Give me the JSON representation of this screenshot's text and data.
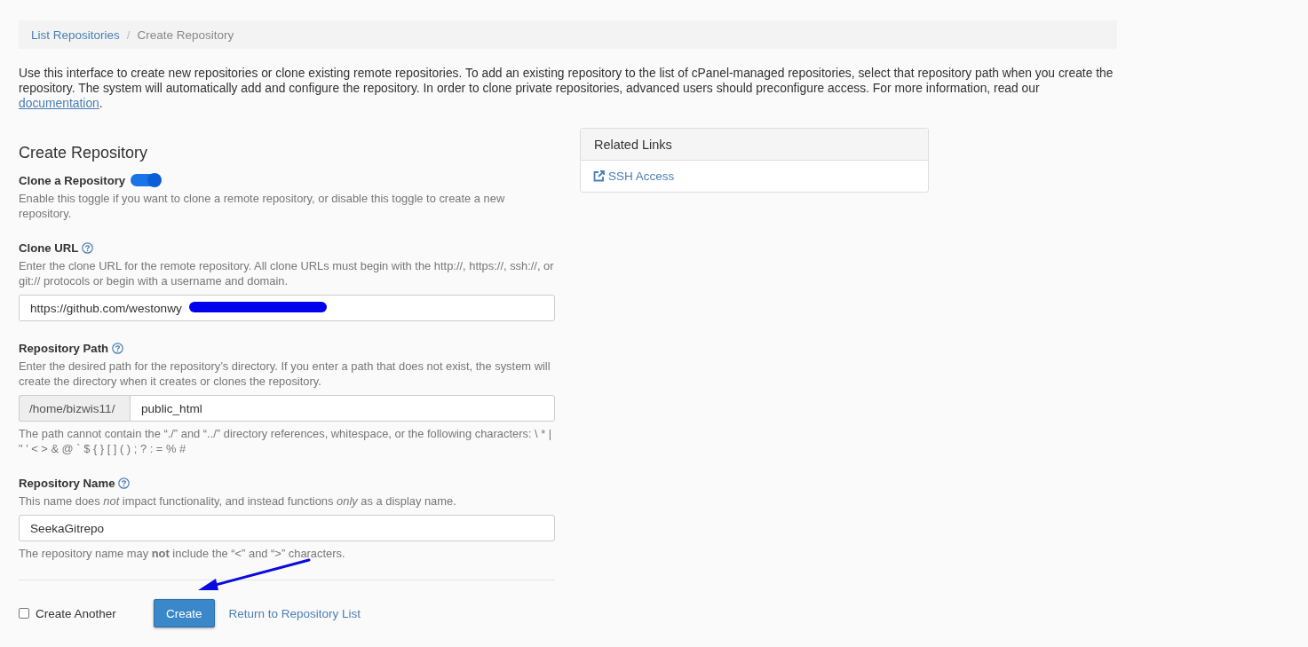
{
  "breadcrumb": {
    "separator": "/",
    "items": [
      {
        "label": "List Repositories",
        "kind": "link"
      },
      {
        "label": "Create Repository",
        "kind": "current"
      }
    ]
  },
  "intro": {
    "text": "Use this interface to create new repositories or clone existing remote repositories. To add an existing repository to the list of cPanel-managed repositories, select that repository path when you create the repository. The system will automatically add and configure the repository. In order to clone private repositories, advanced users should preconfigure access. For more information, read our",
    "link": "documentation",
    "suffix": "."
  },
  "form": {
    "title": "Create Repository",
    "fields": [
      {
        "kind": "toggle",
        "label": "Clone a Repository",
        "on": true,
        "help": "Enable this toggle if you want to clone a remote repository, or disable this toggle to create a new repository."
      },
      {
        "kind": "text",
        "label": "Clone URL",
        "help": "Enter the clone URL for the remote repository. All clone URLs must begin with the http://, https://, ssh://, or git:// protocols or begin with a username and domain.",
        "value": "https://github.com/westonwy",
        "redacted": true
      },
      {
        "kind": "path",
        "label": "Repository Path",
        "help": "Enter the desired path for the repository’s directory. If you enter a path that does not exist, the system will create the directory when it creates or clones the repository.",
        "prefix": "/home/bizwis11/",
        "value": "public_html",
        "note": "The path cannot contain the “./” and “../” directory references, whitespace, or the following characters: \\ * | \" ' < > & @ ` $ { } [ ] ( ) ; ? : = % #"
      },
      {
        "kind": "text",
        "label": "Repository Name",
        "help": "This name does *not* impact functionality, and instead functions *only* as a display name.",
        "value": "SeekaGitrepo",
        "note": "The repository name may **not** include the “<” and “>” characters."
      }
    ]
  },
  "footer": {
    "create_another": {
      "label": "Create Another",
      "checked": false
    },
    "submit": "Create",
    "return_link": "Return to Repository List"
  },
  "related_links": {
    "title": "Related Links",
    "items": [
      {
        "label": "SSH Access"
      }
    ]
  }
}
